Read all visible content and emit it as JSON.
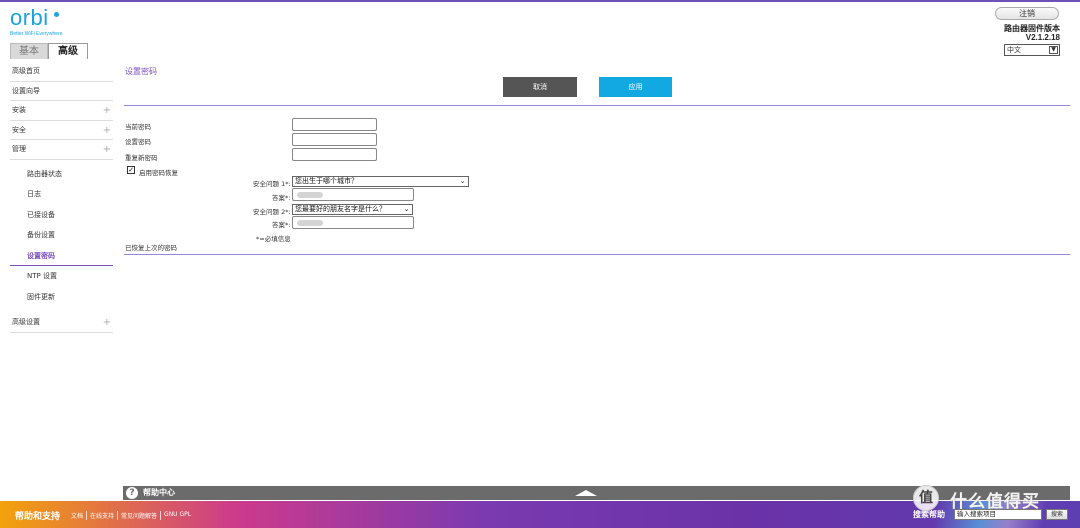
{
  "brand": {
    "logo_text": "orbi",
    "tagline": "Better WiFi Everywhere"
  },
  "tabs": [
    {
      "label": "基本",
      "active": false
    },
    {
      "label": "高级",
      "active": true
    }
  ],
  "header": {
    "logout_label": "注销",
    "firmware_label": "路由器固件版本",
    "firmware_version": "V2.1.2.18",
    "language": "中文"
  },
  "sidebar": {
    "items": [
      {
        "label": "高级首页",
        "expandable": false
      },
      {
        "label": "设置向导",
        "expandable": false
      },
      {
        "label": "安装",
        "expandable": true
      },
      {
        "label": "安全",
        "expandable": true
      },
      {
        "label": "管理",
        "expandable": true
      }
    ],
    "sub_items": [
      {
        "label": "路由器状态",
        "active": false
      },
      {
        "label": "日志",
        "active": false
      },
      {
        "label": "已接设备",
        "active": false
      },
      {
        "label": "备份设置",
        "active": false
      },
      {
        "label": "设置密码",
        "active": true
      },
      {
        "label": "NTP 设置",
        "active": false
      },
      {
        "label": "固件更新",
        "active": false
      }
    ],
    "advanced": {
      "label": "高级设置",
      "expandable": true
    }
  },
  "main": {
    "title": "设置密码",
    "cancel_label": "取消",
    "apply_label": "应用",
    "current_password_label": "当前密码",
    "new_password_label": "设置密码",
    "repeat_password_label": "重复新密码",
    "enable_recovery_label": "启用密码恢复",
    "enable_recovery_checked": true,
    "question1_label": "安全问题 1*:",
    "question1_value": "您出生于哪个城市？",
    "answer1_label": "答案*:",
    "question2_label": "安全问题 2*:",
    "question2_value": "您最要好的朋友名字是什么？",
    "answer2_label": "答案*:",
    "required_note": "*=必填信息",
    "recovered_note": "已恢复上次的密码"
  },
  "help_bar": {
    "icon": "question-icon",
    "title": "帮助中心"
  },
  "footer": {
    "title": "帮助和支持",
    "links": [
      "文档",
      "在线支持",
      "常见问题解答",
      "GNU GPL"
    ],
    "search_label": "搜索帮助",
    "search_placeholder": "输入搜索项目",
    "search_button": "搜索"
  },
  "watermark": {
    "icon": "值",
    "text": "什么值得买"
  },
  "colors": {
    "accent": "#7a4fbe",
    "apply_button": "#12a8e2",
    "cancel_button": "#555555",
    "logo": "#1aa3dc"
  }
}
